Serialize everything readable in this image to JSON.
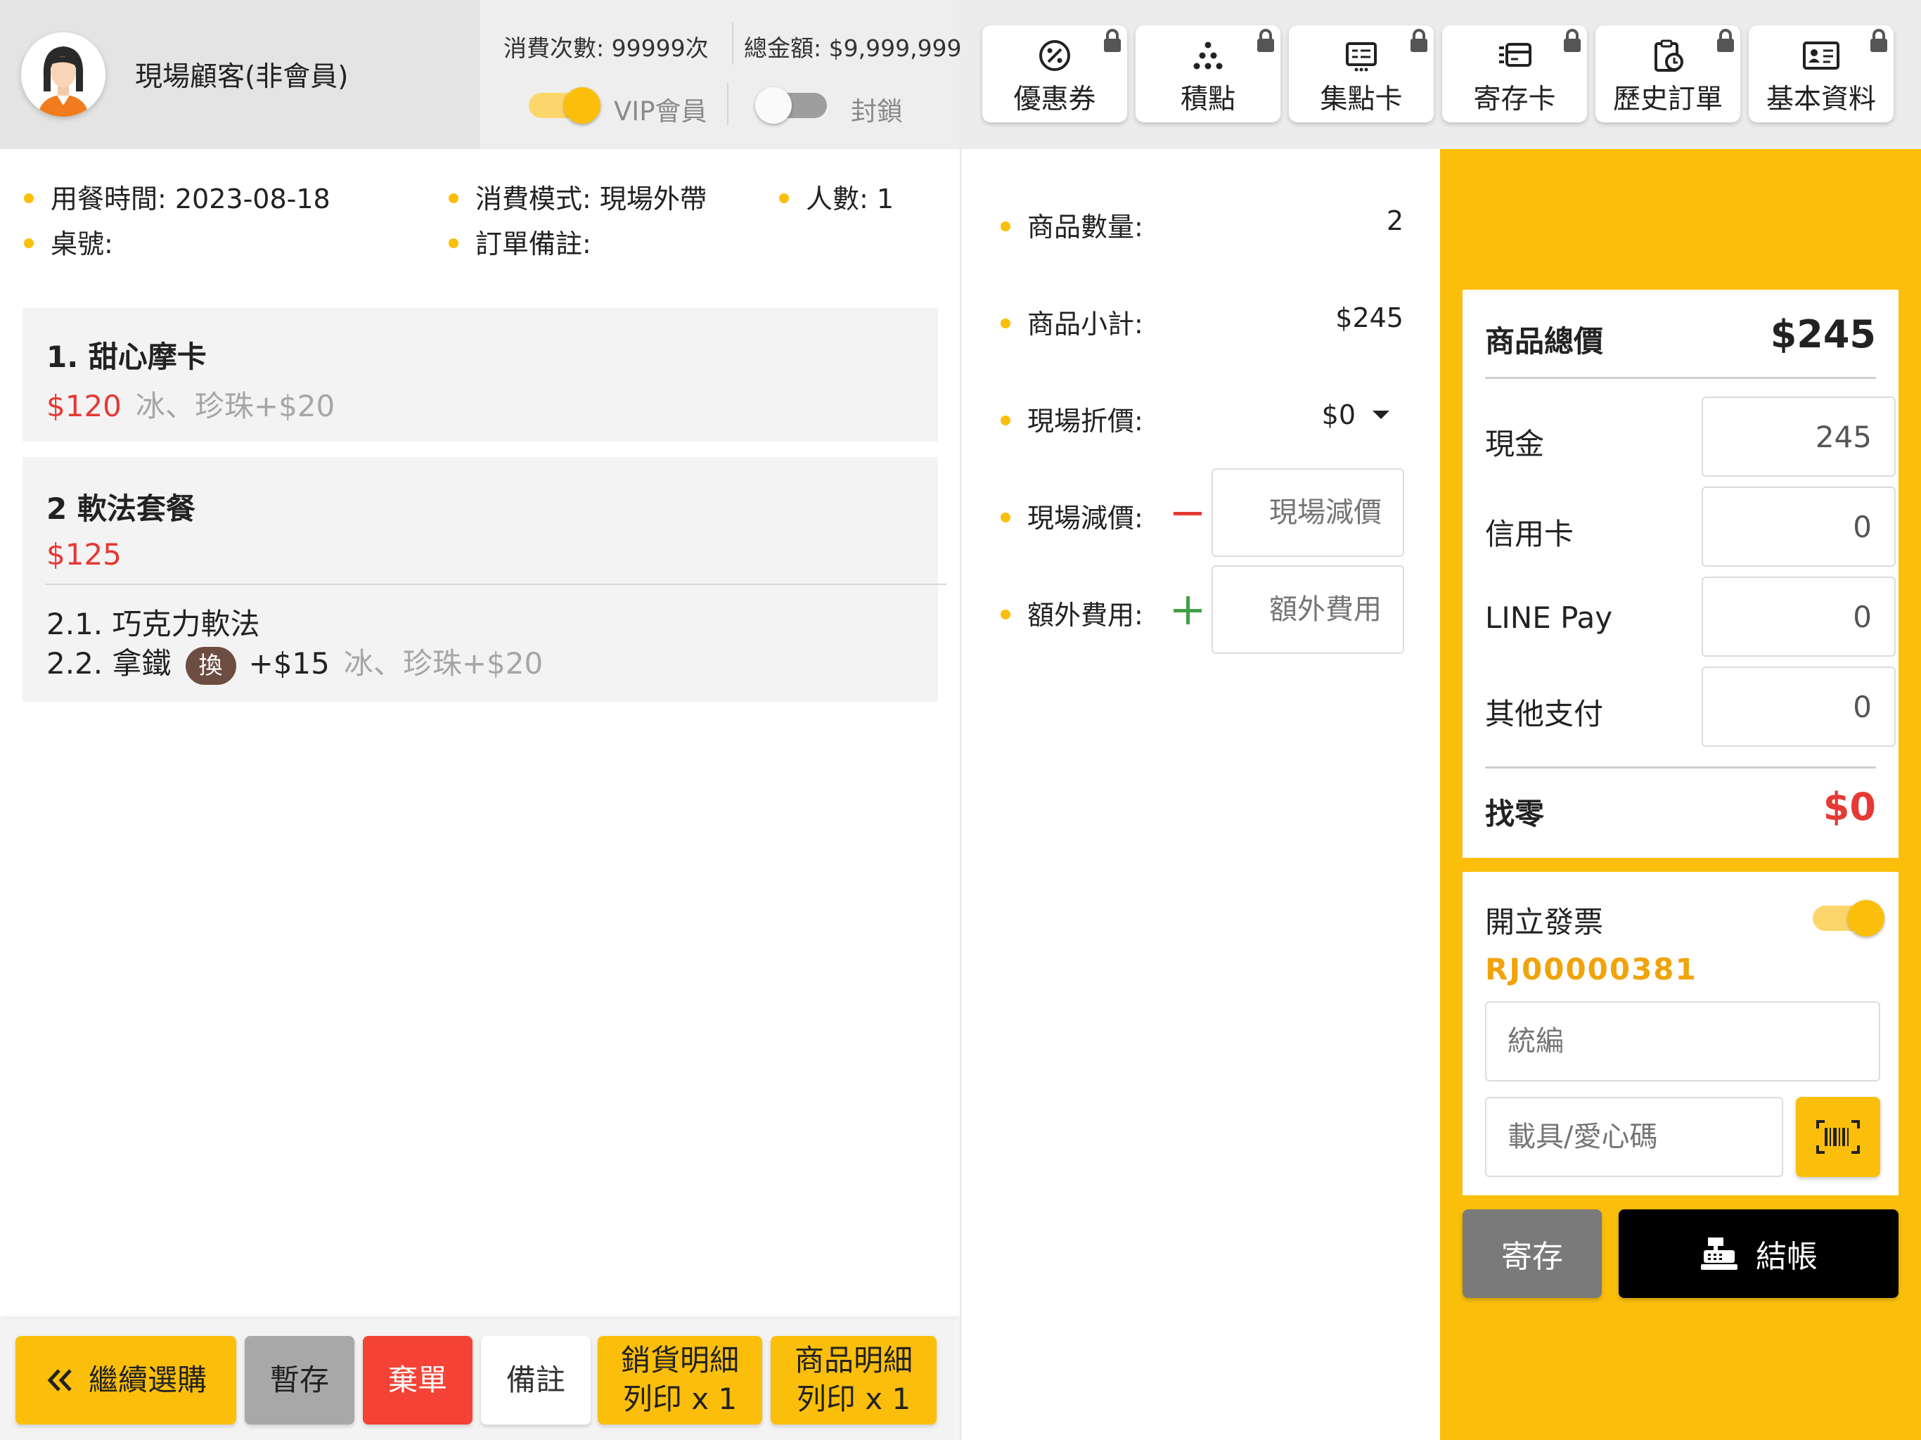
{
  "customer": {
    "name": "現場顧客(非會員)"
  },
  "stats": {
    "visits": "消費次數: 99999次",
    "total": "總金額: $9,999,999"
  },
  "toggles": {
    "vip_label": "VIP會員",
    "vip_on": true,
    "block_label": "封鎖",
    "block_on": false
  },
  "tabs": [
    {
      "label": "優惠券",
      "icon": "percent-icon"
    },
    {
      "label": "積點",
      "icon": "dots-icon"
    },
    {
      "label": "集點卡",
      "icon": "stamp-card-icon"
    },
    {
      "label": "寄存卡",
      "icon": "storage-card-icon"
    },
    {
      "label": "歷史訂單",
      "icon": "history-icon"
    },
    {
      "label": "基本資料",
      "icon": "profile-icon"
    }
  ],
  "order_info": {
    "dining_time": "用餐時間: 2023-08-18",
    "mode": "消費模式: 現場外帶",
    "people": "人數: 1",
    "table": "桌號:",
    "note": "訂單備註:"
  },
  "items": [
    {
      "title": "1. 甜心摩卡",
      "price": "$120",
      "options": "冰、珍珠+$20"
    },
    {
      "title": "2 軟法套餐",
      "price": "$125",
      "subitems": [
        {
          "label": "2.1. 巧克力軟法"
        },
        {
          "label": "2.2. 拿鐵",
          "badge": "換",
          "extra": "+$15",
          "options": "冰、珍珠+$20"
        }
      ]
    }
  ],
  "bottom_buttons": {
    "continue": "繼續選購",
    "hold": "暫存",
    "discard": "棄單",
    "note": "備註",
    "print_sales_1": "銷貨明細",
    "print_sales_2": "列印 x 1",
    "print_items_1": "商品明細",
    "print_items_2": "列印 x 1"
  },
  "summary": {
    "qty_label": "商品數量:",
    "qty_value": "2",
    "subtotal_label": "商品小計:",
    "subtotal_value": "$245",
    "discount_label": "現場折價:",
    "discount_value": "$0",
    "reduction_label": "現場減價:",
    "reduction_placeholder": "現場減價",
    "extra_label": "額外費用:",
    "extra_placeholder": "額外費用"
  },
  "payment": {
    "total_label": "商品總價",
    "total_value": "$245",
    "cash_label": "現金",
    "cash_value": "245",
    "credit_label": "信用卡",
    "credit_value": "0",
    "linepay_label": "LINE Pay",
    "linepay_value": "0",
    "other_label": "其他支付",
    "other_value": "0",
    "change_label": "找零",
    "change_value": "$0"
  },
  "invoice": {
    "label": "開立發票",
    "on": true,
    "number": "RJ00000381",
    "tax_id_placeholder": "統編",
    "carrier_placeholder": "載具/愛心碼"
  },
  "actions": {
    "store": "寄存",
    "checkout": "結帳"
  },
  "colors": {
    "accent": "#fbbf0b",
    "price": "#e53935",
    "change": "#e53935",
    "invoice_no": "#f0a30a",
    "badge": "#6d4c41"
  }
}
